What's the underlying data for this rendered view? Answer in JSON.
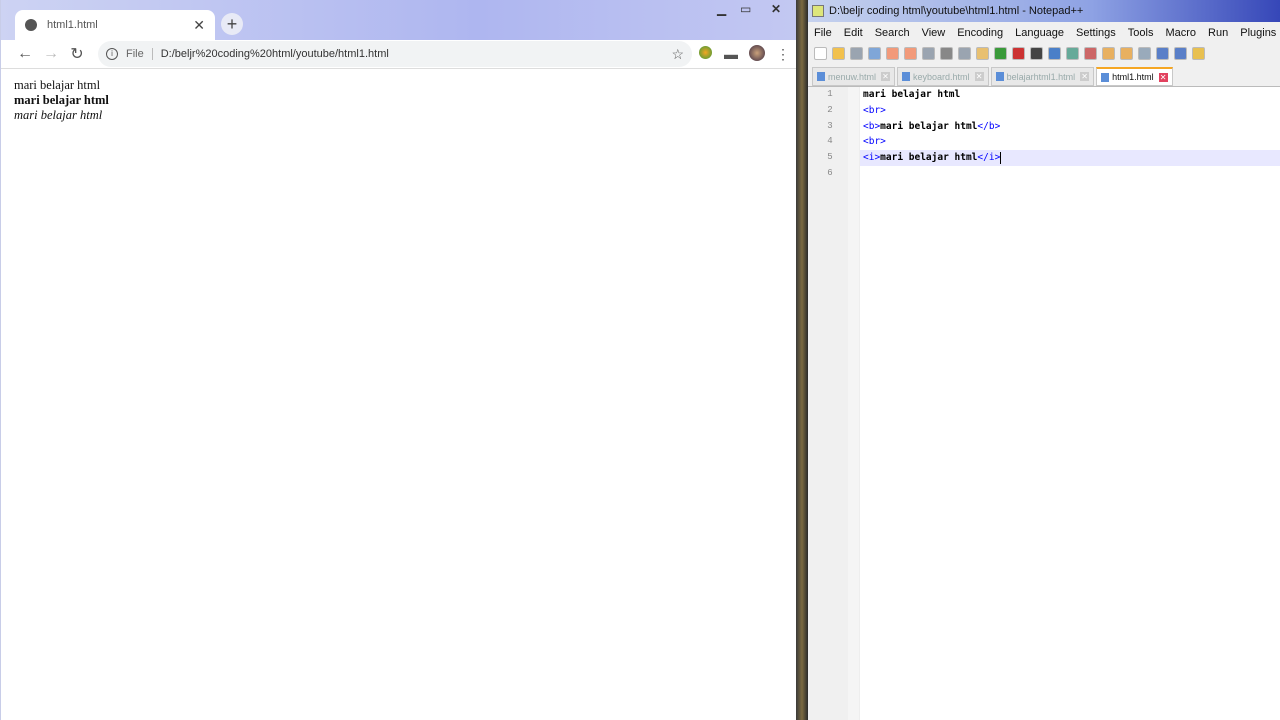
{
  "browser": {
    "tab_title": "html1.html",
    "address_prefix": "File",
    "url": "D:/beljr%20coding%20html/youtube/html1.html",
    "content": [
      "mari belajar html",
      "mari belajar html",
      "mari belajar html"
    ]
  },
  "notepad": {
    "title": "D:\\beljr coding html\\youtube\\html1.html - Notepad++",
    "menu": [
      "File",
      "Edit",
      "Search",
      "View",
      "Encoding",
      "Language",
      "Settings",
      "Tools",
      "Macro",
      "Run",
      "Plugins",
      "Windo"
    ],
    "toolbar_icons": [
      "new-icon",
      "open-icon",
      "save-icon",
      "save-all-icon",
      "close-icon",
      "close-all-icon",
      "print-icon",
      "cut-icon",
      "copy-icon",
      "paste-icon",
      "undo-icon",
      "redo-icon",
      "find-icon",
      "replace-icon",
      "zoom-in-icon",
      "zoom-out-icon",
      "sync-v-icon",
      "sync-h-icon",
      "wrap-icon",
      "show-all-chars-icon",
      "indent-guide-icon",
      "doc-map-icon"
    ],
    "tabs": [
      {
        "label": "menuw.html",
        "active": false
      },
      {
        "label": "keyboard.html",
        "active": false
      },
      {
        "label": "belajarhtml1.html",
        "active": false
      },
      {
        "label": "html1.html",
        "active": true
      }
    ],
    "lines": [
      {
        "n": "1",
        "parts": [
          {
            "t": "mari belajar html",
            "tag": false
          }
        ]
      },
      {
        "n": "2",
        "parts": [
          {
            "t": "<br>",
            "tag": true
          }
        ]
      },
      {
        "n": "3",
        "parts": [
          {
            "t": "<b>",
            "tag": true
          },
          {
            "t": "mari belajar html",
            "tag": false
          },
          {
            "t": "</b>",
            "tag": true
          }
        ]
      },
      {
        "n": "4",
        "parts": [
          {
            "t": "<br>",
            "tag": true
          }
        ]
      },
      {
        "n": "5",
        "parts": [
          {
            "t": "<i>",
            "tag": true
          },
          {
            "t": "mari belajar html",
            "tag": false
          },
          {
            "t": "</i>",
            "tag": true
          }
        ],
        "current": true
      },
      {
        "n": "6",
        "parts": []
      }
    ]
  }
}
